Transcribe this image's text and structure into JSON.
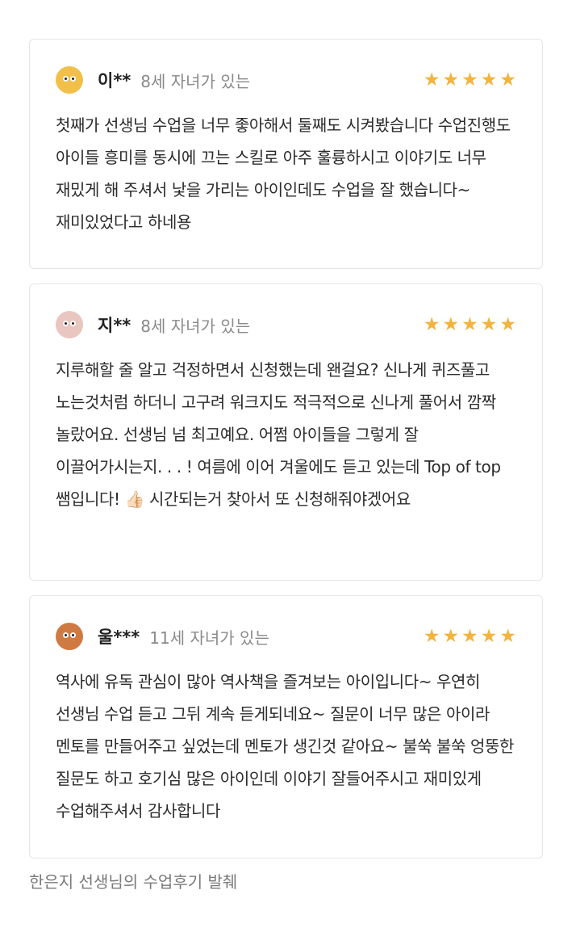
{
  "reviews": [
    {
      "name": "이**",
      "meta": "8세 자녀가 있는",
      "avatar_color": "#f2c04a",
      "rating": 5,
      "text": "첫째가 선생님 수업을 너무 좋아해서 둘째도 시켜봤습니다 수업진행도 아이들 흥미를 동시에 끄는 스킬로 아주 훌륭하시고 이야기도 너무 재밌게 해 주셔서 낯을 가리는 아이인데도 수업을 잘 했습니다~ 재미있었다고 하네용"
    },
    {
      "name": "지**",
      "meta": "8세 자녀가 있는",
      "avatar_color": "#e9c6c0",
      "rating": 5,
      "text": "지루해할 줄 알고 걱정하면서 신청했는데 왠걸요? 신나게 퀴즈풀고 노는것처럼 하더니 고구려 워크지도 적극적으로 신나게 풀어서 깜짝 놀랐어요. 선생님 넘 최고예요. 어쩜 아이들을 그렇게 잘 이끌어가시는지. . . ! 여름에 이어 겨울에도 듣고 있는데 Top of top 쌤입니다! 👍🏻 시간되는거 찾아서 또 신청해줘야겠어요"
    },
    {
      "name": "울***",
      "meta": "11세 자녀가 있는",
      "avatar_color": "#d07a43",
      "rating": 5,
      "text": "역사에 유독 관심이 많아 역사책을 즐겨보는 아이입니다~ 우연히 선생님 수업 듣고 그뒤 계속 듣게되네요~ 질문이 너무 많은 아이라 멘토를 만들어주고 싶었는데 멘토가 생긴것 같아요~ 불쑥 불쑥 엉뚱한 질문도 하고 호기심 많은 아이인데 이야기 잘들어주시고 재미있게 수업해주셔서 감사합니다"
    }
  ],
  "caption": "한은지 선생님의 수업후기 발췌",
  "colors": {
    "star": "#f3b33d",
    "border": "#e6e6e6"
  }
}
